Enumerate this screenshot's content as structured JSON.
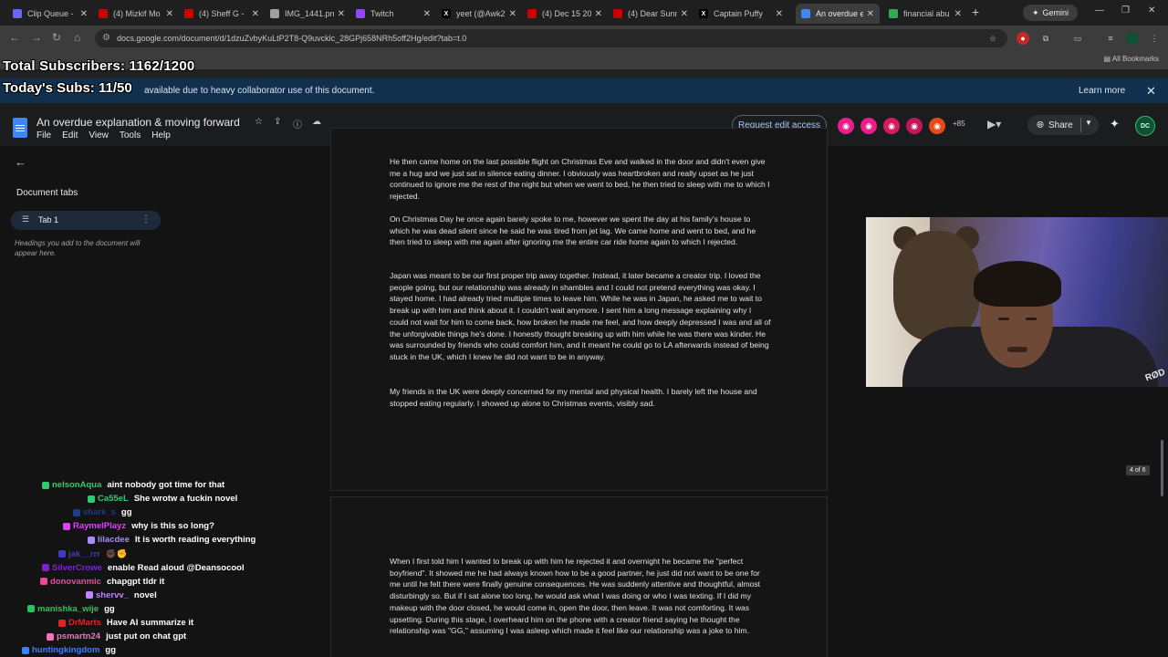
{
  "browser": {
    "tabs": [
      {
        "title": "Clip Queue -",
        "favicon_color": "#6c63ff",
        "active": false
      },
      {
        "title": "(4) Mizkif Mo",
        "favicon_color": "#cc0000",
        "active": false
      },
      {
        "title": "(4) Sheff G -",
        "favicon_color": "#cc0000",
        "active": false
      },
      {
        "title": "IMG_1441.pn",
        "favicon_color": "#9aa0a6",
        "active": false
      },
      {
        "title": "Twitch",
        "favicon_color": "#9146ff",
        "active": false
      },
      {
        "title": "yeet (@Awk2",
        "favicon_color": "#000000",
        "active": false
      },
      {
        "title": "(4) Dec 15 20",
        "favicon_color": "#cc0000",
        "active": false
      },
      {
        "title": "(4) Dear Sunn",
        "favicon_color": "#cc0000",
        "active": false
      },
      {
        "title": "Captain Puffy",
        "favicon_color": "#000000",
        "active": false
      },
      {
        "title": "An overdue e",
        "favicon_color": "#4285f4",
        "active": true
      },
      {
        "title": "financial abu",
        "favicon_color": "#34a853",
        "active": false
      }
    ],
    "gemini_label": "Gemini",
    "url": "docs.google.com/document/d/1dzuZvbyKuLtP2T8-Q9uvcklc_28GPj658NRh5off2Hg/edit?tab=t.0",
    "all_bookmarks": "All Bookmarks"
  },
  "overlay": {
    "total_subs": "Total Subscribers: 1162/1200",
    "today_subs": "Today's Subs: 11/50"
  },
  "banner": {
    "text": "available due to heavy collaborator use of this document.",
    "learn_more": "Learn more"
  },
  "doc": {
    "title": "An overdue explanation & moving forward",
    "menu": [
      "File",
      "Edit",
      "View",
      "Tools",
      "Help"
    ],
    "request_edit": "Request edit access",
    "extra_viewers": "+85",
    "share": "Share",
    "profile_initials": "DC",
    "sidebar": {
      "heading": "Document tabs",
      "tab_label": "Tab 1",
      "hint": "Headings you add to the document will appear here."
    },
    "page1_paragraphs": [
      "He then came home on the last possible flight on Christmas Eve and walked in the door and didn't even give me a hug and we just sat in silence eating dinner. I obviously was heartbroken and really upset as he just continued to ignore me the rest of the night but when we went to bed, he then tried to sleep with me to which I rejected.",
      "On Christmas Day he once again barely spoke to me, however we spent the day at his family's house to which he was dead silent since he said he was tired from jet lag. We came home and went to bed, and he then tried to sleep with me again after ignoring me the entire car ride home again to which I rejected.",
      "Japan was meant to be our first proper trip away together. Instead, it later became a creator trip. I loved the people going, but our relationship was already in shambles and I could not pretend everything was okay. I stayed home. I had already tried multiple times to leave him. While he was in Japan, he asked me to wait to break up with him and think about it. I couldn't wait anymore. I sent him a long message explaining why I could not wait for him to come back, how broken he made me feel, and how deeply depressed I was and all of the unforgivable things he's done. I honestly thought breaking up with him while he was there was kinder. He was surrounded by friends who could comfort him, and it meant he could go to LA afterwards instead of being stuck in the UK, which I knew he did not want to be in anyway.",
      "My friends in the UK were deeply concerned for my mental and physical health. I barely left the house and stopped eating regularly. I showed up alone to Christmas events, visibly sad."
    ],
    "page2_paragraph": "When I first told him I wanted to break up with him he rejected it and overnight he became the \"perfect boyfriend\". It showed me he had always known how to be a good partner, he just did not want to be one for me until he felt there were finally genuine consequences. He was suddenly attentive and thoughtful, almost disturbingly so. But if I sat alone too long, he would ask what I was doing or who I was texting. If I did my makeup with the door closed, he would come in, open the door, then leave. It was not comforting. It was upsetting. During this stage, I overheard him on the phone with a creator friend saying he thought the relationship was \"GG,\" assuming I was asleep which made it feel like our relationship was a joke to him.",
    "page_counter": "4 of 6"
  },
  "webcam": {
    "mic_brand": "RØD"
  },
  "chat": [
    {
      "user": "nelsonAqua",
      "color": "#2ecc71",
      "message": "aint nobody got time for that"
    },
    {
      "user": "Ca55eL",
      "color": "#2ecc71",
      "message": "She wrotw a fuckin novel"
    },
    {
      "user": "shark_s",
      "color": "#1e3a8a",
      "message": "gg"
    },
    {
      "user": "RaymelPlayz",
      "color": "#d946ef",
      "message": "why is this so long?"
    },
    {
      "user": "lilacdee",
      "color": "#a78bfa",
      "message": "It is worth reading everything"
    },
    {
      "user": "jak__rrr",
      "color": "#4338ca",
      "message": "✊🏿✊"
    },
    {
      "user": "SilverCrowe",
      "color": "#7e22ce",
      "message": "enable Read aloud @Deansocool"
    },
    {
      "user": "donovanmic",
      "color": "#ec4899",
      "message": "chapgpt tldr it"
    },
    {
      "user": "shervv_",
      "color": "#c084fc",
      "message": "novel"
    },
    {
      "user": "manishka_wije",
      "color": "#22c55e",
      "message": "gg"
    },
    {
      "user": "DrMarts",
      "color": "#dc2626",
      "message": "Have AI summarize it"
    },
    {
      "user": "psmartn24",
      "color": "#f472b6",
      "message": "just put on chat gpt"
    },
    {
      "user": "huntingkingdom",
      "color": "#3b82f6",
      "message": "gg"
    }
  ]
}
